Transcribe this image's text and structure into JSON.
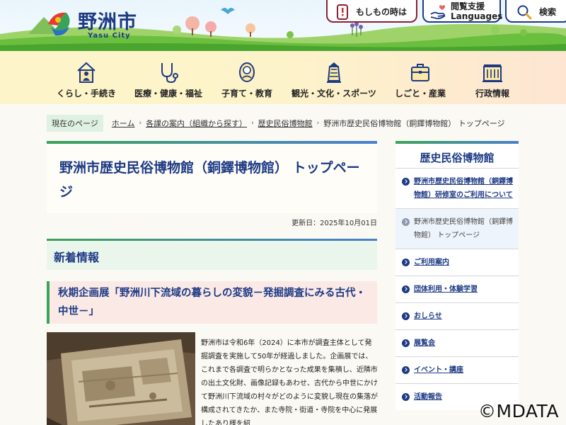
{
  "header": {
    "logo_title": "野洲市",
    "logo_subtitle": "Yasu City",
    "buttons": {
      "emergency": "もしもの時は",
      "lang_line1": "閲覧支援",
      "lang_line2": "Languages",
      "search": "検索"
    }
  },
  "nav": [
    {
      "label": "くらし・手続き",
      "icon": "house-person-icon"
    },
    {
      "label": "医療・健康・福祉",
      "icon": "stethoscope-icon"
    },
    {
      "label": "子育て・教育",
      "icon": "baby-icon"
    },
    {
      "label": "観光・文化・スポーツ",
      "icon": "bell-tower-icon"
    },
    {
      "label": "しごと・産業",
      "icon": "briefcase-icon"
    },
    {
      "label": "行政情報",
      "icon": "city-hall-icon"
    }
  ],
  "breadcrumb": {
    "current_label": "現在のページ",
    "items": [
      "ホーム",
      "各課の案内（組織から探す）",
      "歴史民俗博物館"
    ],
    "here": "野洲市歴史民俗博物館（銅鐸博物館） トップページ"
  },
  "main": {
    "page_title": "野洲市歴史民俗博物館（銅鐸博物館） トップページ",
    "updated": "更新日：2025年10月01日",
    "news_heading": "新着情報",
    "article_title": "秋期企画展「野洲川下流域の暮らしの変貌－発掘調査にみる古代・中世－」",
    "article_body": "野洲市は令和6年（2024）に本市が調査主体として発掘調査を実施して50年が経過しました。企画展では、これまで各調査で明らかとなった成果を集積し、近隣市の出土文化財、画像記録もあわせ、古代から中世にかけて野洲川下流域の村々がどのように変貌し現在の集落が構成されてきたか、また寺院・街道・寺院を中心に発展したあり様を紹"
  },
  "sidebar": {
    "title": "歴史民俗博物館",
    "items": [
      {
        "label": "野洲市歴史民俗博物館（銅鐸博物館）研修室のご利用について",
        "active": false
      },
      {
        "label": "野洲市歴史民俗博物館（銅鐸博物館） トップページ",
        "active": true
      },
      {
        "label": "ご利用案内",
        "active": false
      },
      {
        "label": "団体利用・体験学習",
        "active": false
      },
      {
        "label": "おしらせ",
        "active": false
      },
      {
        "label": "展覧会",
        "active": false
      },
      {
        "label": "イベント・講座",
        "active": false
      },
      {
        "label": "活動報告",
        "active": false
      }
    ]
  },
  "watermark": "©MDATA",
  "colors": {
    "navy": "#1d3a84",
    "green": "#3aa35a",
    "emergency_red": "#8b1f2f"
  }
}
